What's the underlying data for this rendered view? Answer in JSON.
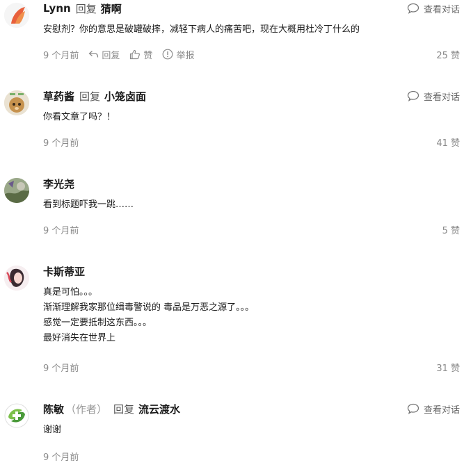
{
  "comments": [
    {
      "author": "Lynn",
      "reply_word": "回复",
      "reply_target": "猜啊",
      "view_conversation": "查看对话",
      "lines": [
        "安慰剂？你的意思是破罐破摔，减轻下病人的痛苦吧，现在大概用杜冷丁什么的"
      ],
      "time": "9 个月前",
      "reply_action": "回复",
      "like_action": "赞",
      "report_action": "举报",
      "likes": "25 赞",
      "avatar_color": "#e8603c"
    },
    {
      "author": "草药酱",
      "reply_word": "回复",
      "reply_target": "小笼卤面",
      "view_conversation": "查看对话",
      "lines": [
        "你看文章了吗？！"
      ],
      "time": "9 个月前",
      "likes": "41 赞",
      "avatar_color": "#c89b5a"
    },
    {
      "author": "李光尧",
      "lines": [
        "看到标题吓我一跳……"
      ],
      "time": "9 个月前",
      "likes": "5 赞",
      "avatar_color": "#7a8a5a"
    },
    {
      "author": "卡斯蒂亚",
      "lines": [
        "真是可怕。。。",
        "渐渐理解我家那位缉毒警说的 毒品是万恶之源了。。。",
        "感觉一定要抵制这东西。。。",
        "最好消失在世界上"
      ],
      "time": "9 个月前",
      "likes": "31 赞",
      "avatar_color": "#d94a5a"
    },
    {
      "author": "陈敏",
      "author_tag": "（作者）",
      "reply_word": "回复",
      "reply_target": "流云渡水",
      "view_conversation": "查看对话",
      "lines": [
        "谢谢"
      ],
      "time": "9 个月前",
      "avatar_color": "#5cb85c"
    }
  ]
}
